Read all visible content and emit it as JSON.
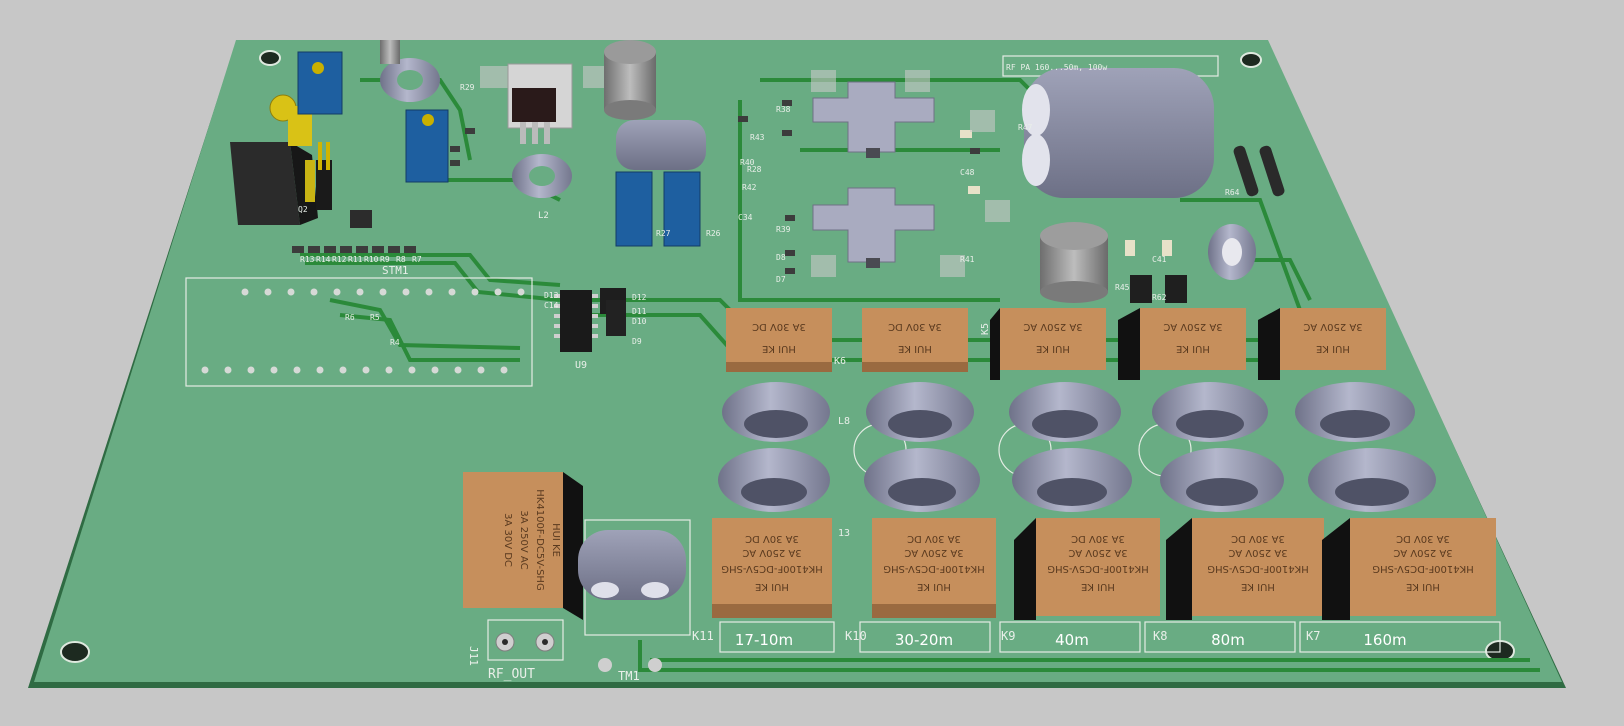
{
  "board": {
    "title_silk": "RF PA 160...50m, 100w",
    "bands": [
      "17-10m",
      "30-20m",
      "40m",
      "80m",
      "160m"
    ],
    "relay_refs": [
      "K11",
      "K10",
      "K9",
      "K8",
      "K7"
    ],
    "top_relay_refs": [
      "K6",
      "",
      "K5",
      "",
      ""
    ],
    "relay_text": {
      "brand": "HUI KE",
      "model": "HK4100F-DC5V-SHG",
      "rating_ac": "3A 250V AC",
      "rating_dc": "3A 30V DC"
    },
    "connector_label": "RF_OUT",
    "connector_ref": "J11",
    "transformer_ref": "TM1",
    "mcu_label": "STM1",
    "ic_ref": "U9",
    "inductor_refs": [
      "L2",
      "L8",
      "13"
    ],
    "part_refs": [
      "R13",
      "R14",
      "R12",
      "R11",
      "R10",
      "R9",
      "R8",
      "R7",
      "R6",
      "R5",
      "R4",
      "R38",
      "R39",
      "R40",
      "R41",
      "R42",
      "R43",
      "R45",
      "R47",
      "R62",
      "R64",
      "R26",
      "R27",
      "R28",
      "R29",
      "D7",
      "D8",
      "D9",
      "D10",
      "D11",
      "D12",
      "D13",
      "C14",
      "C34",
      "C41",
      "C48",
      "Q2"
    ]
  },
  "colors": {
    "board": "#69ac83",
    "trace": "#2b8a3a",
    "relay": "#c68f5c",
    "toroid": "#a4a7bc",
    "pot": "#1e5fa0",
    "background": "#c7c7c7"
  }
}
